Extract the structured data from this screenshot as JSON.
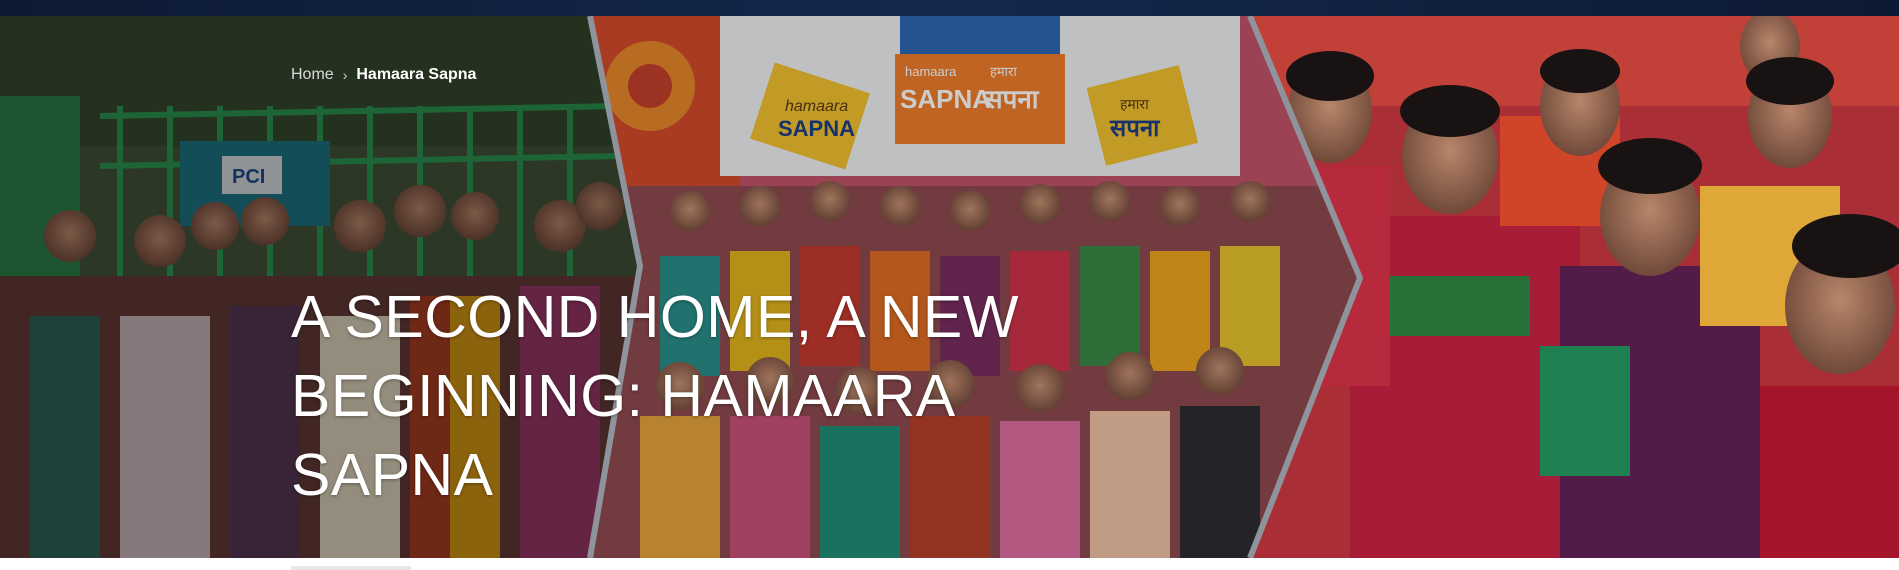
{
  "breadcrumb": {
    "home_label": "Home",
    "separator": "›",
    "current_label": "Hamaara Sapna"
  },
  "hero": {
    "title": "A SECOND HOME, A NEW BEGINNING: HAMAARA SAPNA",
    "banner_texts": {
      "sign_left_top": "hamaara",
      "sign_left_main": "SAPNA",
      "sign_center_left_top": "hamaara",
      "sign_center_left_main": "SAPNA",
      "sign_center_right_top": "हमारा",
      "sign_center_right_main": "सपना",
      "sign_right_top": "हमारा",
      "sign_right_main": "सपना",
      "pci_logo": "PCI"
    }
  },
  "colors": {
    "top_bar": "#14284d",
    "overlay": "#000000",
    "title_text": "#ffffff",
    "divider": "#8f939b",
    "sign_yellow": "#f2c230",
    "sign_orange": "#f07d2e"
  }
}
